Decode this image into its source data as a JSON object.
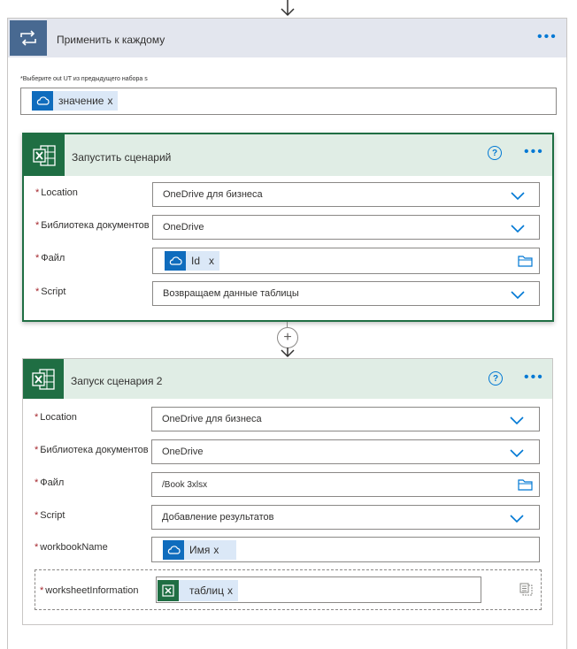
{
  "outer": {
    "title": "Применить к каждому",
    "select_label": "*Выберите out UT из предыдущего набора s",
    "token_label": "значение",
    "token_remove": "x"
  },
  "card1": {
    "title": "Запустить сценарий",
    "fields": {
      "location_label": "Location",
      "location_value": "OneDrive для бизнеса",
      "library_label": "Библиотека документов",
      "library_value": "OneDrive",
      "file_label": "Файл",
      "file_token": "Id",
      "file_token_remove": "x",
      "script_label": "Script",
      "script_value": "Возвращаем данные таблицы"
    }
  },
  "card2": {
    "title": "Запуск сценария 2",
    "fields": {
      "location_label": "Location",
      "location_value": "OneDrive для бизнеса",
      "library_label": "Библиотека документов",
      "library_value": "OneDrive",
      "file_label": "Файл",
      "file_value": "/Book 3xlsx",
      "script_label": "Script",
      "script_value": "Добавление результатов",
      "workbook_label": "workbookName",
      "workbook_token": "Имя",
      "workbook_token_remove": "x",
      "worksheet_label": "worksheetInformation",
      "worksheet_token": "таблиц",
      "worksheet_token_remove": "x"
    }
  },
  "icons": {
    "arrow": "arrow-down-icon",
    "loop": "loop-icon",
    "onedrive": "onedrive-icon",
    "excel": "excel-icon",
    "help": "help-icon",
    "more": "more-icon",
    "chevron": "chevron-down-icon",
    "folder": "folder-icon",
    "add": "add-step-icon",
    "array": "array-switch-icon"
  },
  "colors": {
    "accent": "#0078d4",
    "loop_header": "#486991",
    "excel_green": "#1f6e43",
    "card_header_bg": "#e0ede5",
    "required": "#a4262c"
  }
}
